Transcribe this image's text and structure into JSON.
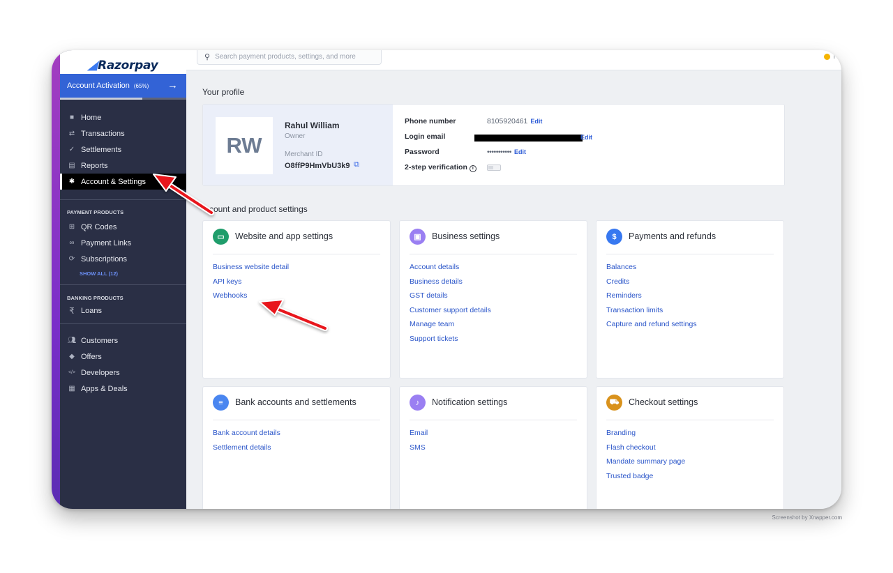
{
  "sidebar": {
    "brand": "Razorpay",
    "activation": {
      "label": "Account Activation",
      "percent_label": "(65%)",
      "progress": 0.65
    },
    "items": [
      {
        "label": "Home",
        "icon": "home-icon"
      },
      {
        "label": "Transactions",
        "icon": "transactions-icon"
      },
      {
        "label": "Settlements",
        "icon": "settlements-icon"
      },
      {
        "label": "Reports",
        "icon": "reports-icon"
      },
      {
        "label": "Account & Settings",
        "icon": "gear-icon",
        "active": true
      }
    ],
    "payment_products": {
      "label": "PAYMENT PRODUCTS",
      "items": [
        "QR Codes",
        "Payment Links",
        "Subscriptions"
      ],
      "show_all": "SHOW ALL (12)"
    },
    "banking_products": {
      "label": "BANKING PRODUCTS",
      "items": [
        "Loans"
      ]
    },
    "more_items": [
      "Customers",
      "Offers",
      "Developers",
      "Apps & Deals"
    ]
  },
  "topbar": {
    "search_placeholder": "Search payment products, settings, and more"
  },
  "profile": {
    "heading": "Your profile",
    "initials": "RW",
    "name": "Rahul William",
    "role": "Owner",
    "merchant_id_label": "Merchant ID",
    "merchant_id": "O8ffP9HmVbU3k9",
    "phone_label": "Phone number",
    "phone": "8105920461",
    "login_email_label": "Login email",
    "password_label": "Password",
    "password_mask": "•••••••••••",
    "two_step_label": "2-step verification",
    "edit": "Edit"
  },
  "settings": {
    "heading": "ccount and product settings",
    "cards": [
      {
        "title": "Website and app settings",
        "icon": "monitor-icon",
        "color": "#1f9d6b",
        "links": [
          "Business website detail",
          "API keys",
          "Webhooks"
        ]
      },
      {
        "title": "Business settings",
        "icon": "business-icon",
        "color": "#9a7ff2",
        "links": [
          "Account details",
          "Business details",
          "GST details",
          "Customer support details",
          "Manage team",
          "Support tickets"
        ]
      },
      {
        "title": "Payments and refunds",
        "icon": "dollar-icon",
        "color": "#3778f0",
        "links": [
          "Balances",
          "Credits",
          "Reminders",
          "Transaction limits",
          "Capture and refund settings"
        ]
      },
      {
        "title": "Bank accounts and settlements",
        "icon": "document-icon",
        "color": "#4a86f0",
        "links": [
          "Bank account details",
          "Settlement details"
        ]
      },
      {
        "title": "Notification settings",
        "icon": "bell-icon",
        "color": "#9a7ff2",
        "links": [
          "Email",
          "SMS"
        ]
      },
      {
        "title": "Checkout settings",
        "icon": "cart-icon",
        "color": "#d9921c",
        "links": [
          "Branding",
          "Flash checkout",
          "Mandate summary page",
          "Trusted badge"
        ]
      }
    ]
  },
  "watermark": "Screenshot by Xnapper.com"
}
